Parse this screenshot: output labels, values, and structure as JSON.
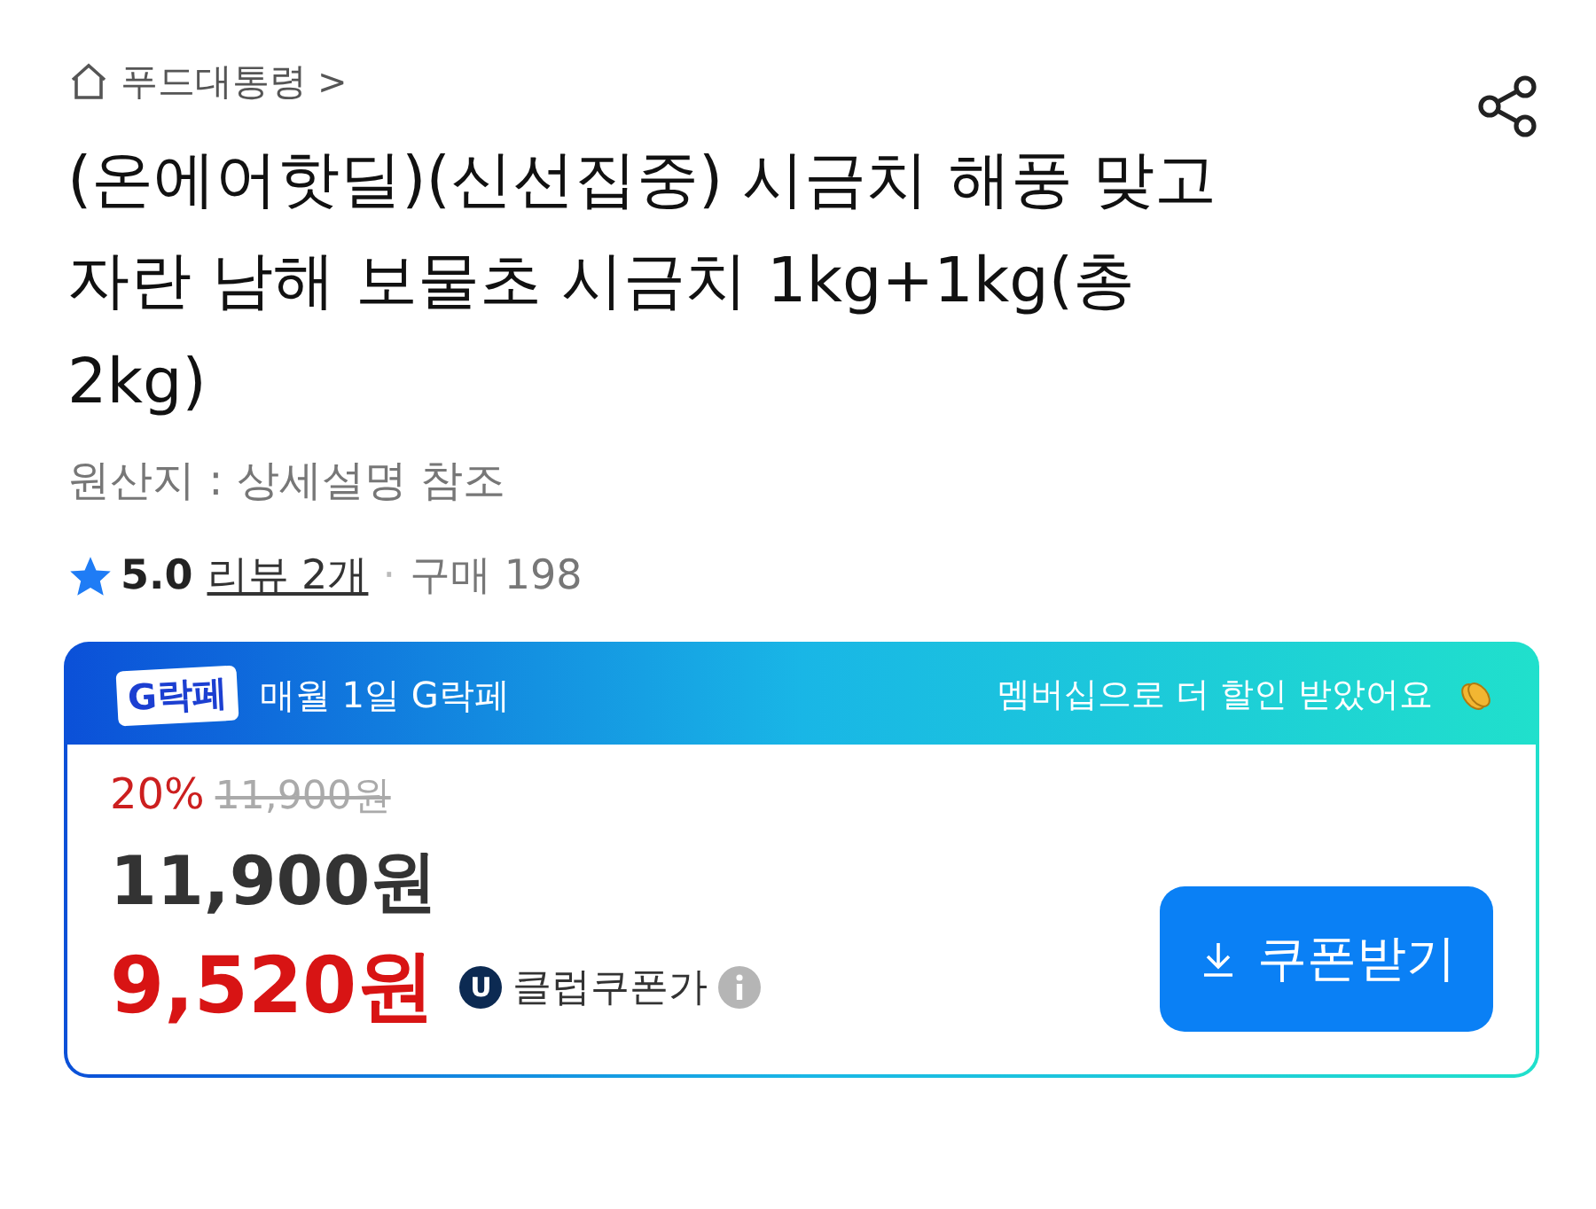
{
  "breadcrumb": {
    "label": "푸드대통령",
    "chevron": ">"
  },
  "title_lines": [
    "(온에어핫딜)(신선집중) 시금치 해풍 맞고",
    "자란 남해 보물초 시금치 1kg+1kg(총",
    "2kg)"
  ],
  "origin": "원산지 : 상세설명 참조",
  "rating": {
    "score": "5.0",
    "reviews": "리뷰 2개",
    "separator": "·",
    "purchases": "구매 198"
  },
  "promo": {
    "logo": "G락페",
    "title": "매월 1일 G락페",
    "message": "멤버십으로 더 할인 받았어요"
  },
  "price": {
    "discount": "20%",
    "original": "11,900원",
    "price": "11,900원",
    "coupon_price": "9,520원",
    "coupon_badge": "U",
    "coupon_label": "클럽쿠폰가",
    "coupon_button": "쿠폰받기"
  }
}
